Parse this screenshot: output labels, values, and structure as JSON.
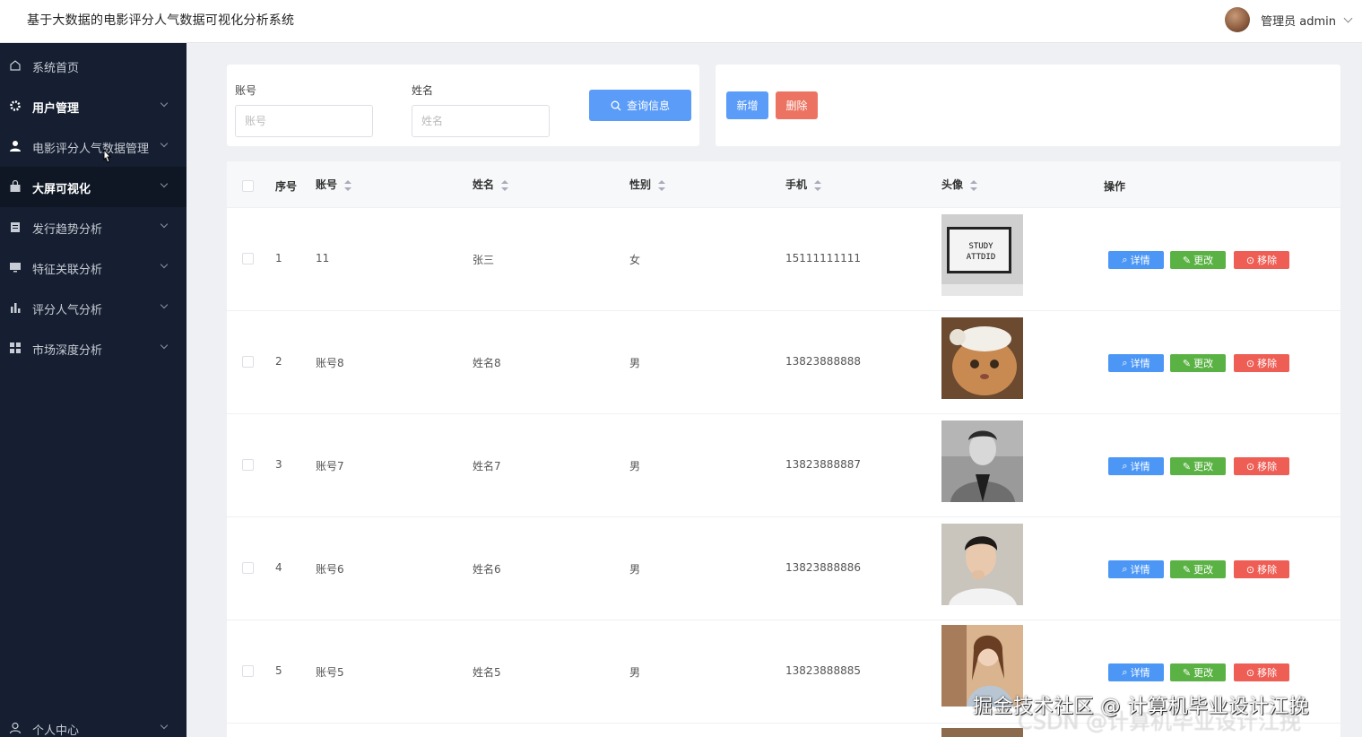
{
  "app": {
    "title": "基于大数据的电影评分人气数据可视化分析系统"
  },
  "user": {
    "label": "管理员 admin"
  },
  "sidebar": {
    "items": [
      {
        "label": "系统首页",
        "icon": "home-icon",
        "bold": false,
        "chevron": false
      },
      {
        "label": "用户管理",
        "icon": "gear-icon",
        "bold": true,
        "chevron": true
      },
      {
        "label": "电影评分人气数据管理",
        "icon": "user-icon",
        "bold": false,
        "chevron": true
      },
      {
        "label": "大屏可视化",
        "icon": "bag-icon",
        "bold": true,
        "chevron": true,
        "active": true
      },
      {
        "label": "发行趋势分析",
        "icon": "clipboard-icon",
        "bold": false,
        "chevron": true
      },
      {
        "label": "特征关联分析",
        "icon": "monitor-icon",
        "bold": false,
        "chevron": true
      },
      {
        "label": "评分人气分析",
        "icon": "bar-chart-icon",
        "bold": false,
        "chevron": true
      },
      {
        "label": "市场深度分析",
        "icon": "grid-icon",
        "bold": false,
        "chevron": true
      }
    ],
    "bottom_item": {
      "label": "个人中心",
      "icon": "person-icon"
    }
  },
  "search": {
    "account_label": "账号",
    "account_placeholder": "账号",
    "name_label": "姓名",
    "name_placeholder": "姓名",
    "query_button": "查询信息"
  },
  "actions": {
    "add": "新增",
    "delete": "删除"
  },
  "table": {
    "headers": {
      "index": "序号",
      "account": "账号",
      "name": "姓名",
      "gender": "性别",
      "phone": "手机",
      "avatar": "头像",
      "ops": "操作"
    },
    "rows": [
      {
        "index": "1",
        "account": "11",
        "name": "张三",
        "gender": "女",
        "phone": "15111111111",
        "photo": "study-attitude-board"
      },
      {
        "index": "2",
        "account": "账号8",
        "name": "姓名8",
        "gender": "男",
        "phone": "13823888888",
        "photo": "cat-with-headband"
      },
      {
        "index": "3",
        "account": "账号7",
        "name": "姓名7",
        "gender": "男",
        "phone": "13823888887",
        "photo": "man-black-white"
      },
      {
        "index": "4",
        "account": "账号6",
        "name": "姓名6",
        "gender": "男",
        "phone": "13823888886",
        "photo": "man-white-shirt"
      },
      {
        "index": "5",
        "account": "账号5",
        "name": "姓名5",
        "gender": "男",
        "phone": "13823888885",
        "photo": "woman-street"
      }
    ],
    "op_labels": {
      "detail": "详情",
      "edit": "更改",
      "remove": "移除"
    }
  },
  "photo_text": {
    "board_line1": "STUDY",
    "board_line2": "ATTDID"
  },
  "watermark": {
    "line1": "掘金技术社区 @ 计算机毕业设计江挽",
    "line2": "CSDN @计算机毕业设计江挽"
  },
  "colors": {
    "sidebar": "#151f31",
    "primary": "#5a9cf8",
    "danger": "#ec7361",
    "success": "#5ab244"
  }
}
